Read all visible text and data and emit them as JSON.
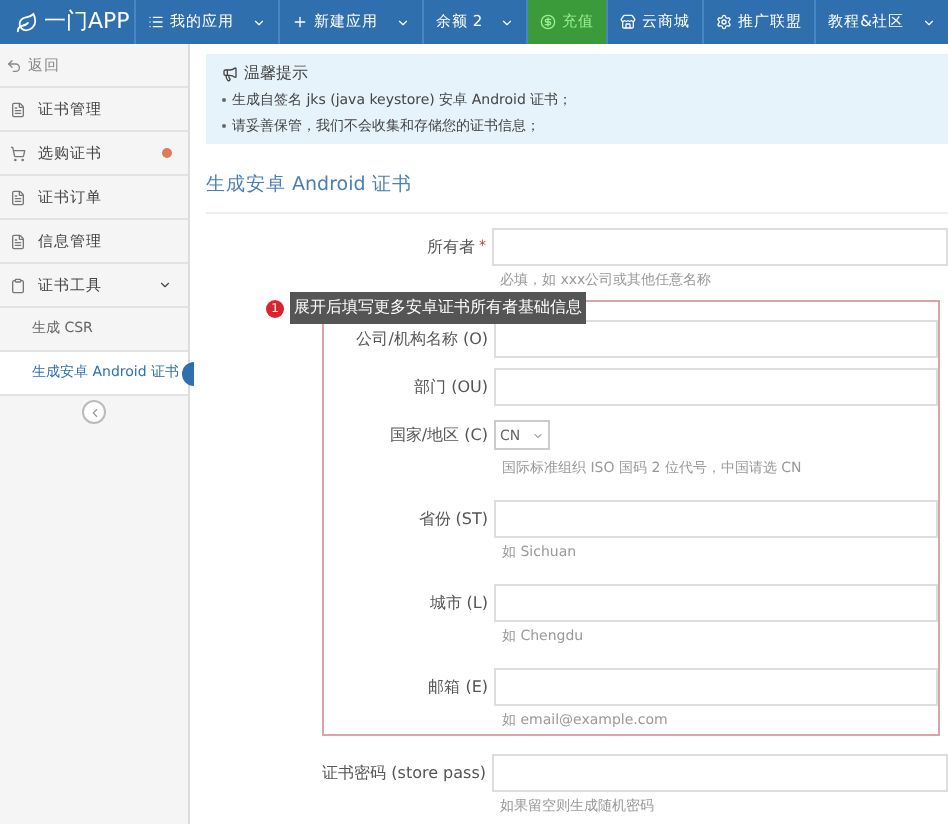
{
  "header": {
    "logo": "一门APP",
    "menu": [
      {
        "label": "我的应用",
        "kind": "dropdown"
      },
      {
        "label": "新建应用",
        "kind": "dropdown"
      },
      {
        "label": "余额 2",
        "kind": "dropdown"
      },
      {
        "label": "充值",
        "kind": "highlight"
      },
      {
        "label": "云商城",
        "kind": "plain"
      },
      {
        "label": "推广联盟",
        "kind": "plain"
      },
      {
        "label": "教程&社区",
        "kind": "dropdown"
      }
    ]
  },
  "sidebar": {
    "back": "返回",
    "items": [
      {
        "label": "证书管理",
        "badge": false
      },
      {
        "label": "选购证书",
        "badge": true
      },
      {
        "label": "证书订单",
        "badge": false
      },
      {
        "label": "信息管理",
        "badge": false
      },
      {
        "label": "证书工具",
        "badge": false,
        "expanded": true,
        "children": [
          {
            "label": "生成 CSR",
            "selected": false
          },
          {
            "label": "生成安卓 Android 证书",
            "selected": true
          }
        ]
      }
    ]
  },
  "notice": {
    "title": "温馨提示",
    "lines": [
      "生成自签名 jks (java keystore) 安卓 Android 证书；",
      "请妥善保管，我们不会收集和存储您的证书信息；"
    ]
  },
  "form": {
    "title": "生成安卓 Android 证书",
    "owner": {
      "label": "所有者",
      "required_mark": "*",
      "help": "必填，如 xxx公司或其他任意名称"
    },
    "tooltip": {
      "badge": "1",
      "text": "展开后填写更多安卓证书所有者基础信息"
    },
    "details": [
      {
        "label": "公司/机构名称 (O)",
        "kind": "input"
      },
      {
        "label": "部门 (OU)",
        "kind": "input"
      },
      {
        "label": "国家/地区 (C)",
        "kind": "select",
        "value": "CN",
        "help": "国际标准组织 ISO 国码 2 位代号，中国请选 CN"
      },
      {
        "label": "省份 (ST)",
        "kind": "input",
        "help": "如 Sichuan"
      },
      {
        "label": "城市 (L)",
        "kind": "input",
        "help": "如 Chengdu"
      },
      {
        "label": "邮箱 (E)",
        "kind": "input",
        "help": "如 email@example.com"
      }
    ],
    "store_pass": {
      "label": "证书密码 (store pass)",
      "help": "如果留空则生成随机密码"
    }
  }
}
